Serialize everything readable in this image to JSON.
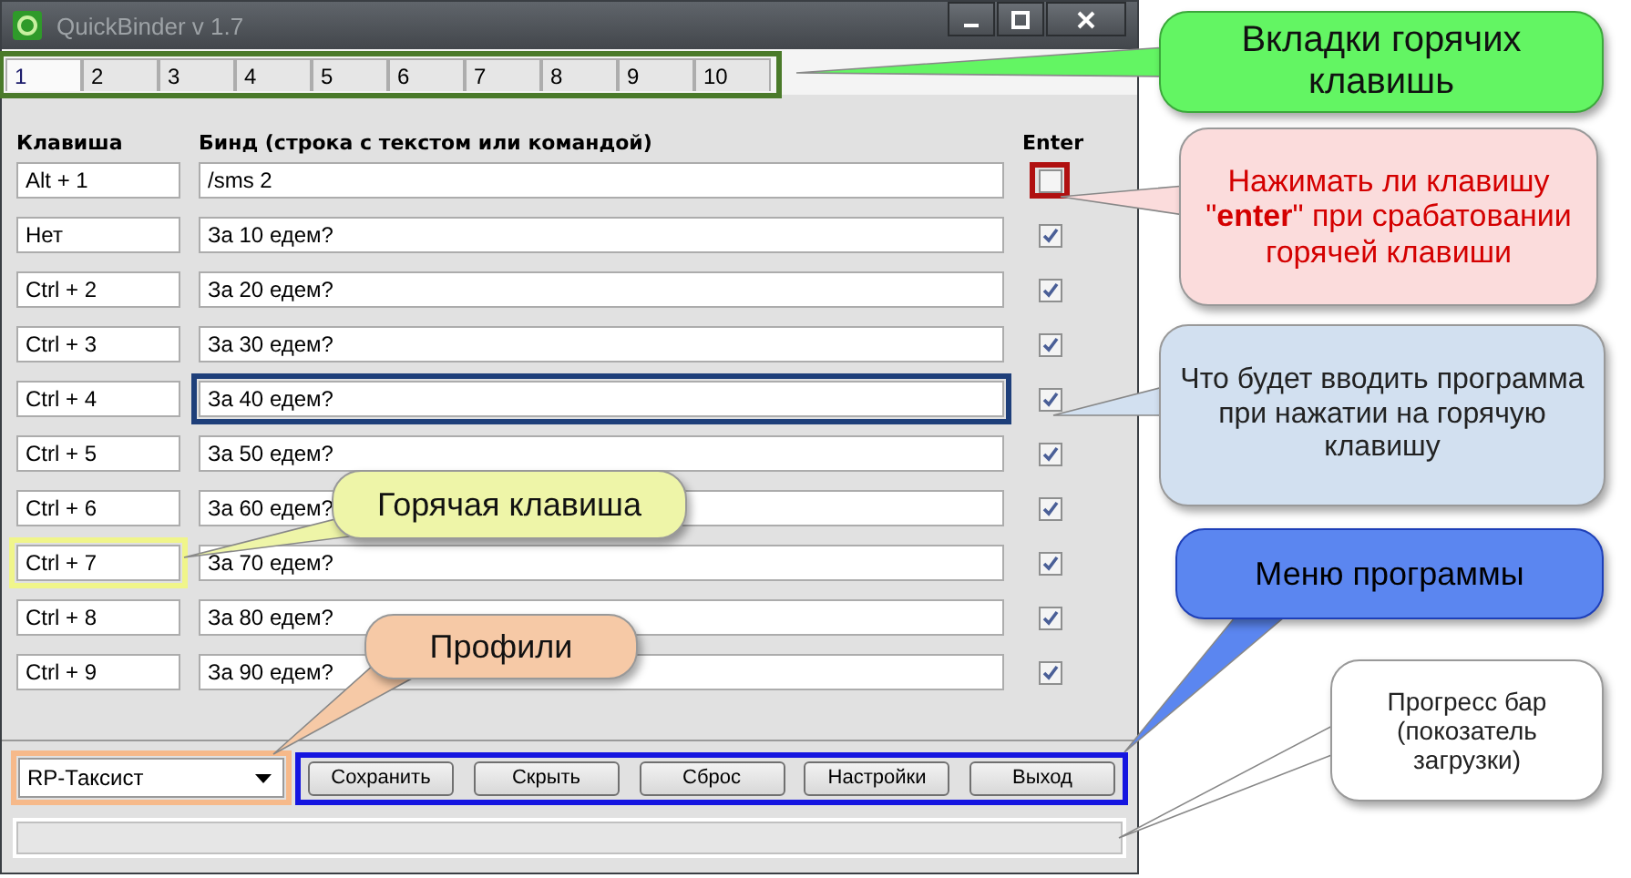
{
  "window": {
    "title": "QuickBinder v 1.7"
  },
  "tabs_highlighted": true,
  "tabs": [
    {
      "label": "1",
      "selected": true
    },
    {
      "label": "2",
      "selected": false
    },
    {
      "label": "3",
      "selected": false
    },
    {
      "label": "4",
      "selected": false
    },
    {
      "label": "5",
      "selected": false
    },
    {
      "label": "6",
      "selected": false
    },
    {
      "label": "7",
      "selected": false
    },
    {
      "label": "8",
      "selected": false
    },
    {
      "label": "9",
      "selected": false
    },
    {
      "label": "10",
      "selected": false
    }
  ],
  "columns": {
    "key": "Клавиша",
    "bind": "Бинд (строка с текстом или командой)",
    "enter": "Enter"
  },
  "rows": [
    {
      "key": "Alt + 1",
      "bind": "/sms 2",
      "enter": false,
      "enter_highlighted": true
    },
    {
      "key": "Нет",
      "bind": "За 10 едем?",
      "enter": true
    },
    {
      "key": "Ctrl + 2",
      "bind": "За 20 едем?",
      "enter": true
    },
    {
      "key": "Ctrl + 3",
      "bind": "За 30 едем?",
      "enter": true
    },
    {
      "key": "Ctrl + 4",
      "bind": "За 40 едем?",
      "enter": true,
      "bind_highlighted": true
    },
    {
      "key": "Ctrl + 5",
      "bind": "За 50 едем?",
      "enter": true
    },
    {
      "key": "Ctrl + 6",
      "bind": "За 60 едем?",
      "enter": true
    },
    {
      "key": "Ctrl + 7",
      "bind": "За 70 едем?",
      "enter": true,
      "key_highlighted": true
    },
    {
      "key": "Ctrl + 8",
      "bind": "За 80 едем?",
      "enter": true
    },
    {
      "key": "Ctrl + 9",
      "bind": "За 90 едем?",
      "enter": true
    }
  ],
  "profile": {
    "value": "RP-Таксист",
    "highlighted": true
  },
  "buttons": {
    "highlighted": true,
    "items": [
      "Сохранить",
      "Скрыть",
      "Сброс",
      "Настройки",
      "Выход"
    ]
  },
  "progress": {
    "level": 0
  },
  "callouts": [
    {
      "kind": "green",
      "text": "Вкладки горячих клавишь"
    },
    {
      "kind": "pink",
      "text": "Нажимать ли клавишу \"**enter**\" при срабатовании горячей клавиши"
    },
    {
      "kind": "lightblue",
      "text": "Что будет вводить программа при нажатии на горячую клавишу"
    },
    {
      "kind": "blue",
      "text": "Меню программы"
    },
    {
      "kind": "white",
      "text": "Прогресс бар (покозатель загрузки)"
    },
    {
      "kind": "yellow",
      "text": "Горячая клавиша"
    },
    {
      "kind": "orange",
      "text": "Профили"
    }
  ]
}
